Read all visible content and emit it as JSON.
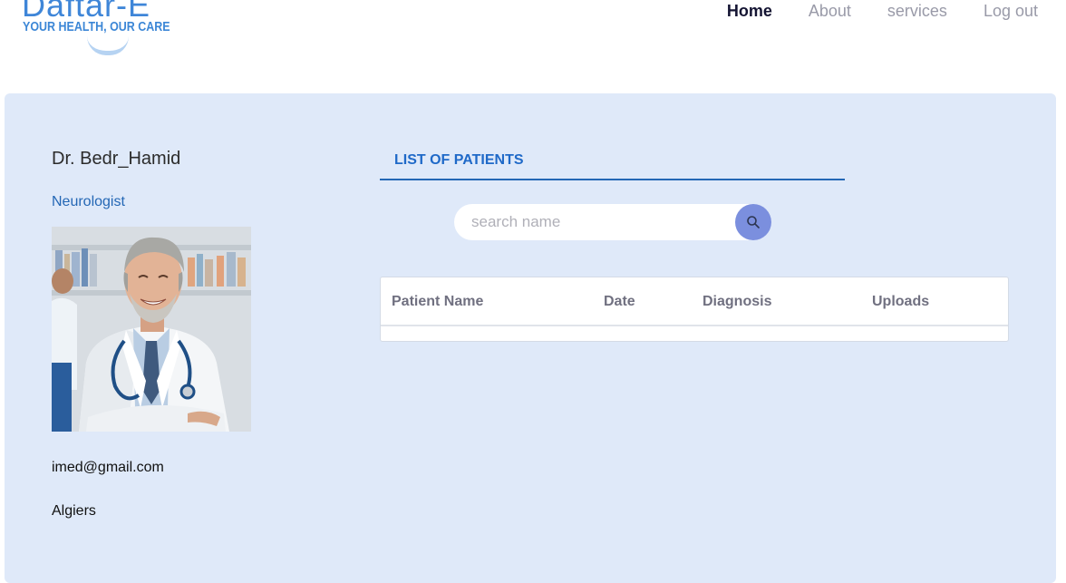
{
  "brand": {
    "name": "Daftar-E",
    "tagline": "YOUR HEALTH, OUR CARE"
  },
  "nav": {
    "home": "Home",
    "about": "About",
    "services": "services",
    "logout": "Log out"
  },
  "doctor": {
    "name": "Dr. Bedr_Hamid",
    "specialty": "Neurologist",
    "email": "imed@gmail.com",
    "city": "Algiers"
  },
  "patients": {
    "title": "LIST OF PATIENTS",
    "search_placeholder": "search name",
    "search_icon": "search-icon",
    "columns": [
      "Patient Name",
      "Date",
      "Diagnosis",
      "Uploads"
    ],
    "rows": []
  },
  "colors": {
    "accent": "#2467b5",
    "panel_bg": "#dfe9f9",
    "search_button": "#7b8fde",
    "nav_active": "#141432",
    "nav_inactive": "#999aa8"
  }
}
